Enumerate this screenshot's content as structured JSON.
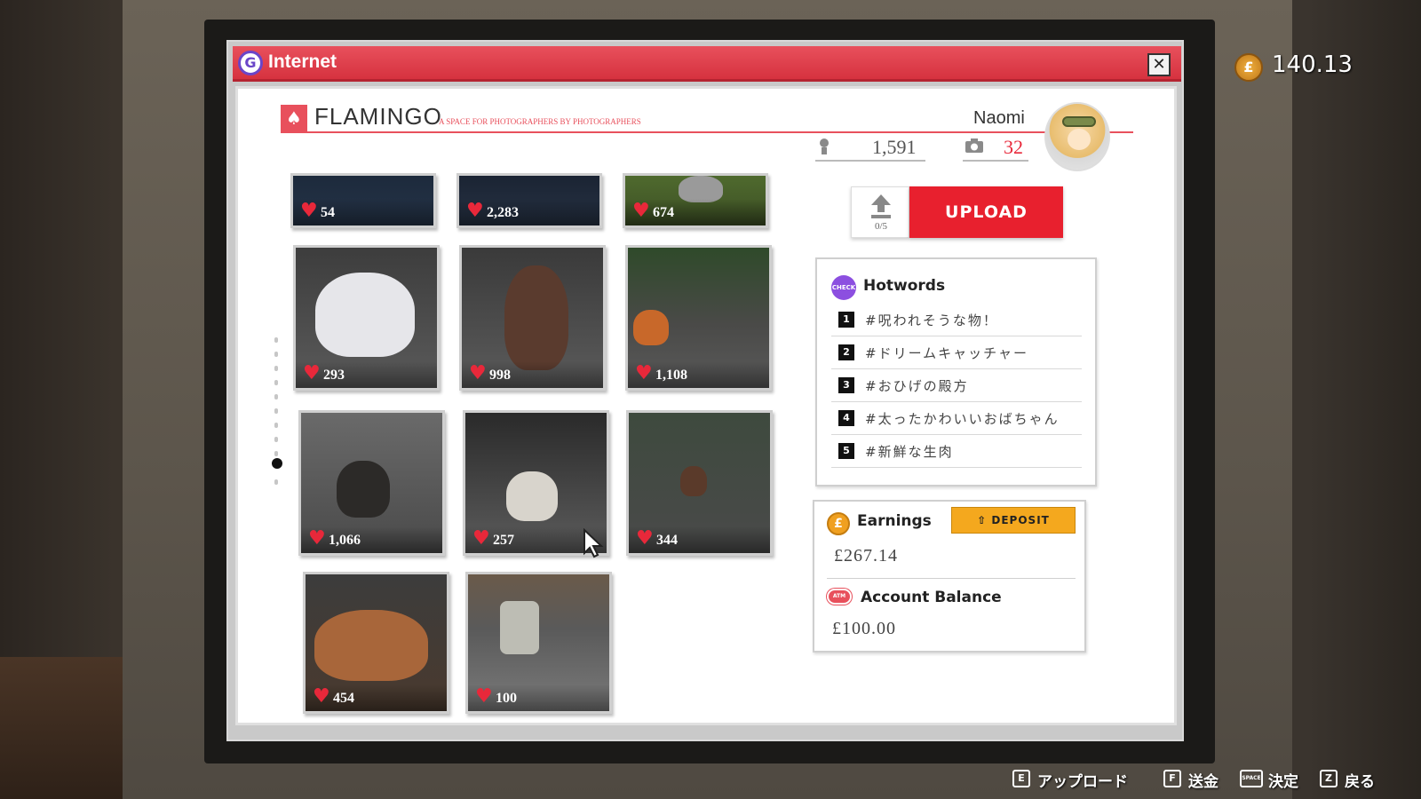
{
  "hud": {
    "currency_symbol": "£",
    "wallet_amount": "140.13"
  },
  "window": {
    "app_icon": "G",
    "title": "Internet",
    "close_label": "✕"
  },
  "site": {
    "logo_glyph": "♠",
    "brand": "FLAMINGO",
    "tagline": "A SPACE FOR PHOTOGRAPHERS BY PHOTOGRAPHERS",
    "accent_color": "#e8505c"
  },
  "profile": {
    "username": "Naomi",
    "followers_icon": "person-icon",
    "followers": "1,591",
    "photos_icon": "camera-icon",
    "photos": "32",
    "photos_color": "#e8283a"
  },
  "gallery": {
    "heart_glyph": "♥",
    "scroll_position": 0.86,
    "photos": [
      {
        "likes": "54"
      },
      {
        "likes": "2,283"
      },
      {
        "likes": "674"
      },
      {
        "likes": "293"
      },
      {
        "likes": "998"
      },
      {
        "likes": "1,108"
      },
      {
        "likes": "1,066"
      },
      {
        "likes": "257"
      },
      {
        "likes": "344"
      },
      {
        "likes": "454"
      },
      {
        "likes": "100"
      }
    ]
  },
  "upload": {
    "count": "0/5",
    "label": "UPLOAD"
  },
  "hotwords": {
    "badge_text": "CHECK",
    "title": "Hotwords",
    "items": [
      {
        "rank": "1",
        "tag": "#呪われそうな物！"
      },
      {
        "rank": "2",
        "tag": "#ドリームキャッチャー"
      },
      {
        "rank": "3",
        "tag": "#おひげの殿方"
      },
      {
        "rank": "4",
        "tag": "#太ったかわいいおばちゃん"
      },
      {
        "rank": "5",
        "tag": "#新鮮な生肉"
      }
    ]
  },
  "earnings": {
    "coin_glyph": "£",
    "title": "Earnings",
    "deposit_label": "DEPOSIT",
    "amount": "£267.14",
    "atm_badge": "ATM",
    "balance_title": "Account Balance",
    "balance": "£100.00"
  },
  "controls": [
    {
      "key": "E",
      "label": "アップロード"
    },
    {
      "key": "F",
      "label": "送金"
    },
    {
      "key": "SPACE",
      "label": "決定"
    },
    {
      "key": "Z",
      "label": "戻る"
    }
  ]
}
